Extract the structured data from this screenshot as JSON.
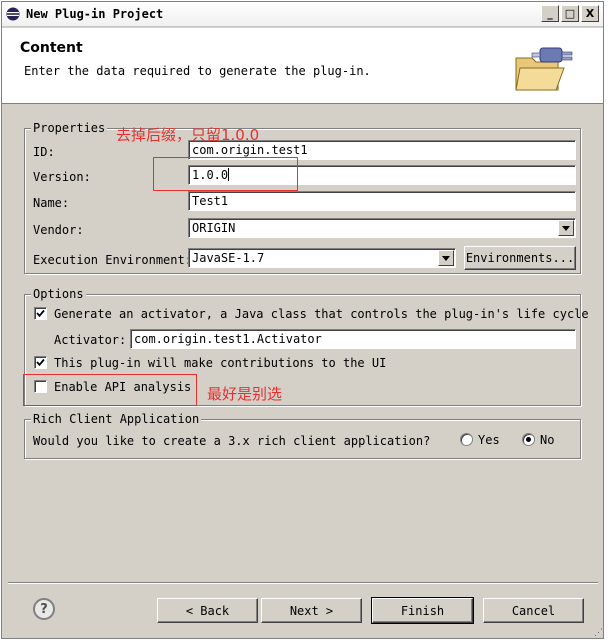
{
  "window": {
    "title": "New Plug-in Project",
    "min_label": "_",
    "max_label": "□",
    "close_label": "X"
  },
  "header": {
    "title": "Content",
    "description": "Enter the data required to generate the plug-in."
  },
  "properties": {
    "group_label": "Properties",
    "id_label": "ID:",
    "id_value": "com.origin.test1",
    "version_label": "Version:",
    "version_value": "1.0.0",
    "name_label": "Name:",
    "name_value": "Test1",
    "vendor_label": "Vendor:",
    "vendor_value": "ORIGIN",
    "env_label": "Execution Environment:",
    "env_value": "JavaSE-1.7",
    "environments_button": "Environments..."
  },
  "options": {
    "group_label": "Options",
    "generate_activator_label": "Generate an activator, a Java class that controls the plug-in's life cycle",
    "generate_activator_checked": true,
    "activator_label": "Activator:",
    "activator_value": "com.origin.test1.Activator",
    "contributions_label": "This plug-in will make contributions to the UI",
    "contributions_checked": true,
    "api_analysis_label": "Enable API analysis",
    "api_analysis_checked": false
  },
  "rca": {
    "group_label": "Rich Client Application",
    "question": "Would you like to create a 3.x rich client application?",
    "yes_label": "Yes",
    "no_label": "No",
    "selected": "No"
  },
  "annotations": {
    "version_note": "去掉后缀，只留1.0.0",
    "api_note": "最好是别选"
  },
  "footer": {
    "help_label": "?",
    "back_button": "< Back",
    "next_button": "Next >",
    "finish_button": "Finish",
    "cancel_button": "Cancel"
  }
}
